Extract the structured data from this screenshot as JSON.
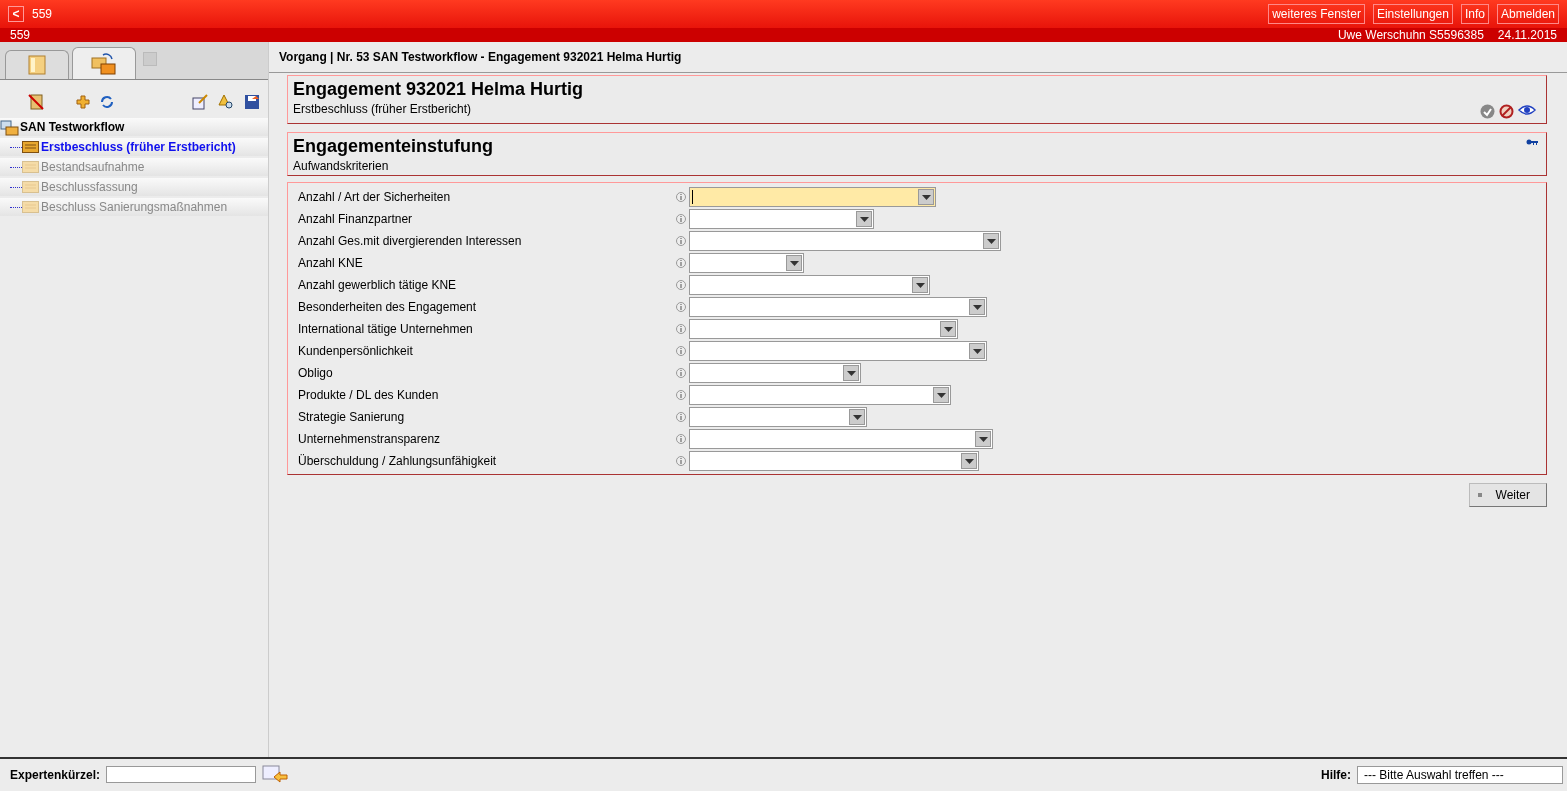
{
  "header": {
    "back": "<",
    "title": "559",
    "subtitle": "559",
    "buttons": [
      "weiteres Fenster",
      "Einstellungen",
      "Info",
      "Abmelden"
    ],
    "user": "Uwe Werschuhn S5596385",
    "date": "24.11.2015"
  },
  "sidebar": {
    "tabs": [
      {
        "selected": false
      },
      {
        "selected": true
      }
    ],
    "tree": {
      "label": "SAN Testworkflow",
      "children": [
        {
          "label": "Erstbeschluss (früher Erstbericht)",
          "selected": true,
          "disabled": false
        },
        {
          "label": "Bestandsaufnahme",
          "selected": false,
          "disabled": true
        },
        {
          "label": "Beschlussfassung",
          "selected": false,
          "disabled": true
        },
        {
          "label": "Beschluss Sanierungsmaßnahmen",
          "selected": false,
          "disabled": true
        }
      ]
    }
  },
  "breadcrumb": "Vorgang | Nr. 53 SAN Testworkflow - Engagement 932021 Helma Hurtig",
  "header_card": {
    "title": "Engagement 932021 Helma Hurtig",
    "subtitle": "Erstbeschluss (früher Erstbericht)"
  },
  "section": {
    "title": "Engagementeinstufung",
    "subtitle": "Aufwandskriterien"
  },
  "fields": [
    {
      "label": "Anzahl / Art der Sicherheiten",
      "focused": true
    },
    {
      "label": "Anzahl Finanzpartner",
      "focused": false
    },
    {
      "label": "Anzahl Ges.mit divergierenden Interessen",
      "focused": false
    },
    {
      "label": "Anzahl KNE",
      "focused": false
    },
    {
      "label": "Anzahl gewerblich tätige KNE",
      "focused": false
    },
    {
      "label": "Besonderheiten des Engagement",
      "focused": false
    },
    {
      "label": "International tätige Unternehmen",
      "focused": false
    },
    {
      "label": "Kundenpersönlichkeit",
      "focused": false
    },
    {
      "label": "Obligo",
      "focused": false
    },
    {
      "label": "Produkte / DL des Kunden",
      "focused": false
    },
    {
      "label": "Strategie Sanierung",
      "focused": false
    },
    {
      "label": "Unternehmenstransparenz",
      "focused": false
    },
    {
      "label": "Überschuldung / Zahlungsunfähigkeit",
      "focused": false
    }
  ],
  "next_button": "Weiter",
  "footer": {
    "expert_label": "Expertenkürzel:",
    "help_label": "Hilfe:",
    "help_value": "--- Bitte Auswahl treffen ---"
  }
}
